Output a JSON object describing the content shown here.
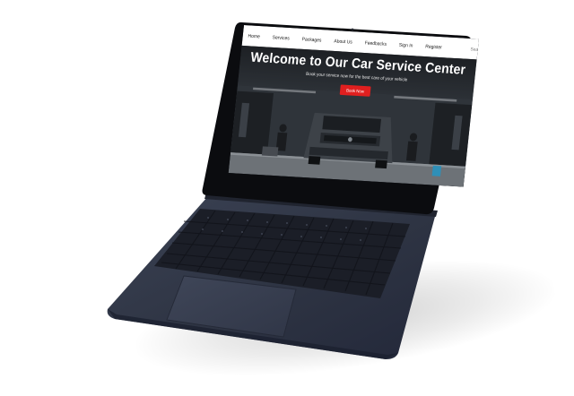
{
  "nav": {
    "links": [
      "Home",
      "Services",
      "Packages",
      "About Us",
      "Feedbacks",
      "Sign In",
      "Register"
    ],
    "search_placeholder": "Search"
  },
  "hero": {
    "title": "Welcome to Our Car Service Center",
    "subtitle": "Book your service now for the best care of your vehicle",
    "cta_label": "Book Now"
  },
  "colors": {
    "nav_bg": "#ffffff",
    "cta": "#e01f1f",
    "laptop_body": "#2c3140",
    "bezel": "#0b0c0f"
  },
  "icons": [
    "laptop-device"
  ]
}
